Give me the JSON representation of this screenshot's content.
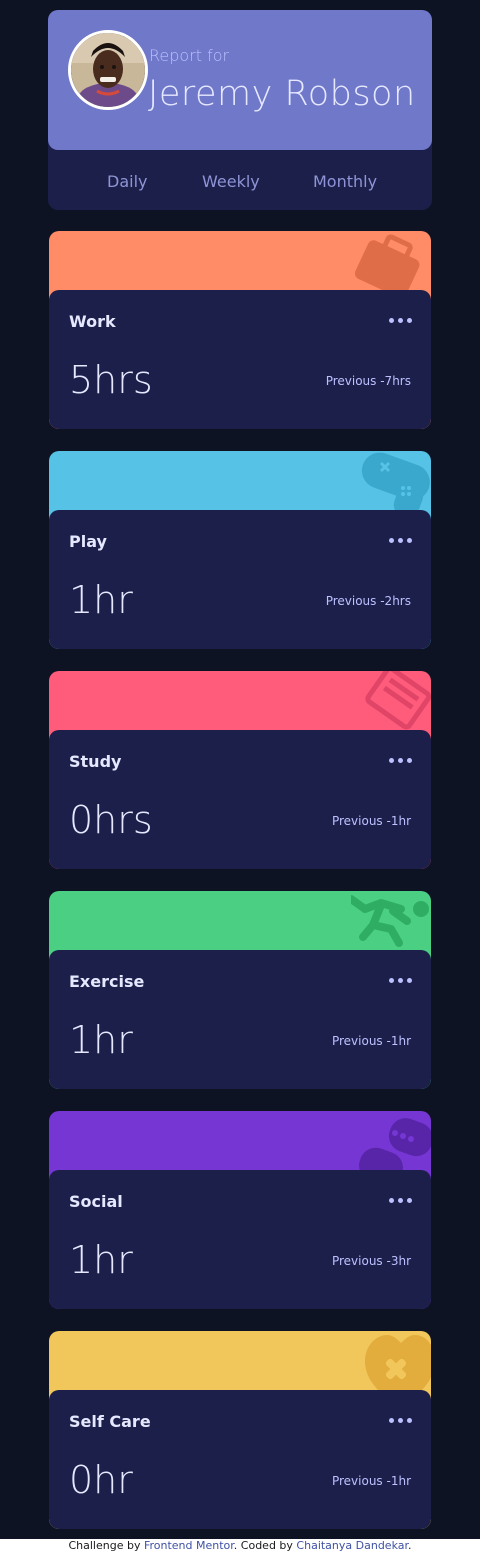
{
  "profile": {
    "report_for": "Report for",
    "name": "Jeremy Robson",
    "avatar_alt": "avatar"
  },
  "periods": [
    {
      "label": "Daily"
    },
    {
      "label": "Weekly"
    },
    {
      "label": "Monthly"
    }
  ],
  "cards": [
    {
      "title": "Work",
      "current": "5hrs",
      "previous": "Previous -7hrs",
      "color": "#ff8c66",
      "icon": "briefcase-icon"
    },
    {
      "title": "Play",
      "current": "1hr",
      "previous": "Previous -2hrs",
      "color": "#56c2e6",
      "icon": "gamepad-icon"
    },
    {
      "title": "Study",
      "current": "0hrs",
      "previous": "Previous -1hr",
      "color": "#ff5c7c",
      "icon": "books-icon"
    },
    {
      "title": "Exercise",
      "current": "1hr",
      "previous": "Previous -1hr",
      "color": "#4bcf82",
      "icon": "running-figure-icon"
    },
    {
      "title": "Social",
      "current": "1hr",
      "previous": "Previous -3hr",
      "color": "#7536d3",
      "icon": "chat-bubbles-icon"
    },
    {
      "title": "Self Care",
      "current": "0hr",
      "previous": "Previous -1hr",
      "color": "#f1c75b",
      "icon": "heart-bandage-icon"
    }
  ],
  "footer": {
    "prefix": "Challenge by ",
    "link1": "Frontend Mentor",
    "middle": ". Coded by ",
    "link2": "Chaitanya Dandekar",
    "suffix": "."
  }
}
